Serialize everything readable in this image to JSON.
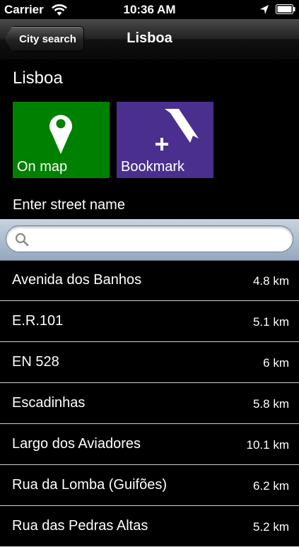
{
  "status_bar": {
    "carrier": "Carrier",
    "time": "10:36 AM",
    "icons": [
      "wifi-icon",
      "location-arrow-icon",
      "battery-icon"
    ]
  },
  "navbar": {
    "back_label": "City search",
    "title": "Lisboa"
  },
  "city_name": "Lisboa",
  "tiles": {
    "on_map": {
      "label": "On map",
      "icon": "map-pin-icon",
      "color": "#008000"
    },
    "bookmark": {
      "label": "Bookmark",
      "icon": "add-bookmark-icon",
      "color": "#4b2f8f"
    }
  },
  "street_label": "Enter street name",
  "search": {
    "value": "",
    "placeholder": ""
  },
  "streets": [
    {
      "name": "Avenida dos Banhos",
      "distance": "4.8 km"
    },
    {
      "name": "E.R.101",
      "distance": "5.1 km"
    },
    {
      "name": "EN 528",
      "distance": "6 km"
    },
    {
      "name": "Escadinhas",
      "distance": "5.8 km"
    },
    {
      "name": "Largo dos Aviadores",
      "distance": "10.1 km"
    },
    {
      "name": "Rua da Lomba (Guifões)",
      "distance": "6.2 km"
    },
    {
      "name": "Rua das Pedras Altas",
      "distance": "5.2 km"
    }
  ]
}
